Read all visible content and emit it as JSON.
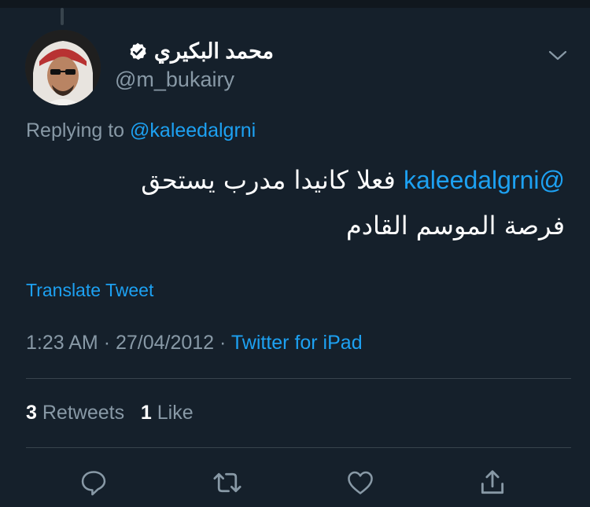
{
  "tweet": {
    "author_name": "محمد البكيري",
    "author_handle": "@m_bukairy",
    "replying_label": "Replying to",
    "replying_to": "@kaleedalgrni",
    "mention": "@kaleedalgrni",
    "text_line1": "فعلا كانيدا مدرب يستحق",
    "text_line2": "فرصة الموسم القادم",
    "translate_label": "Translate Tweet",
    "time": "1:23 AM",
    "separator": "·",
    "date": "27/04/2012",
    "source": "Twitter for iPad",
    "retweets_count": "3",
    "retweets_label": "Retweets",
    "likes_count": "1",
    "likes_label": "Like"
  },
  "icons": {
    "reply": "reply-icon",
    "retweet": "retweet-icon",
    "like": "heart-icon",
    "share": "share-icon",
    "verified": "verified-badge-icon",
    "menu": "chevron-down-icon"
  },
  "colors": {
    "background": "#15202b",
    "accent": "#1da1f2",
    "secondary_text": "#8899a6",
    "divider": "#38444d"
  }
}
